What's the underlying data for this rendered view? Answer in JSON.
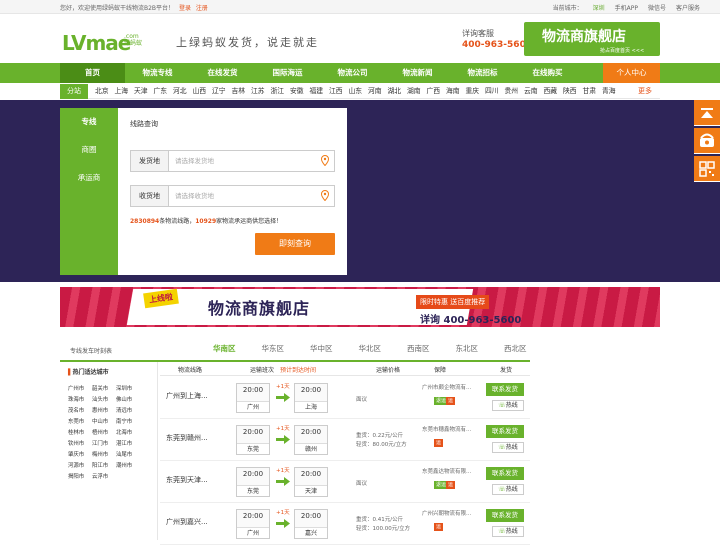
{
  "topbar": {
    "welcome": "您好，欢迎使用绿蚂蚁干线物流B2B平台！",
    "login": "登录",
    "register": "注册",
    "current_city_label": "当前城市：",
    "current_city": "深圳",
    "mobile_app": "手机APP",
    "wechat": "微信号",
    "service": "客户服务"
  },
  "header": {
    "logo_text": "LVmae",
    "logo_sub1": ".com",
    "logo_sub2": "绿蚂蚁",
    "slogan": "上绿蚂蚁发货，说走就走",
    "hotline_label": "详询客服",
    "hotline": "400-963-5600",
    "banner_title": "物流商旗舰店",
    "banner_sub": "抢占百度首页 <<<"
  },
  "nav": {
    "items": [
      "首页",
      "物流专线",
      "在线发货",
      "国际海运",
      "物流公司",
      "物流新闻",
      "物流招标",
      "在线购买"
    ],
    "user_center": "个人中心"
  },
  "provinces": {
    "tag": "分站",
    "list": [
      "北京",
      "上海",
      "天津",
      "广东",
      "河北",
      "山西",
      "辽宁",
      "吉林",
      "江苏",
      "浙江",
      "安徽",
      "福建",
      "江西",
      "山东",
      "河南",
      "湖北",
      "湖南",
      "广西",
      "海南",
      "重庆",
      "四川",
      "贵州",
      "云南",
      "西藏",
      "陕西",
      "甘肃",
      "青海"
    ],
    "more": "更多"
  },
  "search_panel": {
    "tabs": [
      "专线",
      "商圈",
      "承运商"
    ],
    "title": "线路查询",
    "from_label": "发货地",
    "from_placeholder": "请选择发货地",
    "to_label": "收货地",
    "to_placeholder": "请选择收货地",
    "stat_lines": "2830894",
    "stat_text1": "条物流线路，",
    "stat_carriers": "10929",
    "stat_text2": "家物流承运商供您选择！",
    "query_button": "即刻查询"
  },
  "ad": {
    "online": "上线啦",
    "title": "物流商旗舰店",
    "promo": "限时特惠 送百度推荐",
    "phone": "详询 400-963-5600"
  },
  "lines_section": {
    "title": "专线发车时刻表",
    "region_tabs": [
      "华南区",
      "华东区",
      "华中区",
      "华北区",
      "西南区",
      "东北区",
      "西北区"
    ],
    "hot_cities_title": "热门适达城市",
    "hot_cities": [
      "广州市",
      "韶关市",
      "深圳市",
      "珠海市",
      "汕头市",
      "佛山市",
      "茂名市",
      "惠州市",
      "清远市",
      "东莞市",
      "中山市",
      "南宁市",
      "桂林市",
      "梧州市",
      "北海市",
      "钦州市",
      "江门市",
      "湛江市",
      "肇庆市",
      "梅州市",
      "汕尾市",
      "河源市",
      "阳江市",
      "潮州市",
      "揭阳市",
      "云浮市"
    ],
    "columns": [
      "物流线路",
      "运输班次",
      "预计到达时间",
      "运输价格",
      "保障",
      "发货"
    ],
    "rows": [
      {
        "route": "广州到上海...",
        "dep_time": "20:00",
        "dep_city": "广州",
        "plus": "+1天",
        "arr_time": "20:00",
        "arr_city": "上海",
        "price_lines": [
          "面议"
        ],
        "company": "广州市颇企物流有...",
        "badges": [
          "退运",
          "运"
        ],
        "contact": "联系发货",
        "hotline": "热线"
      },
      {
        "route": "东莞到赣州...",
        "dep_time": "20:00",
        "dep_city": "东莞",
        "plus": "+1天",
        "arr_time": "20:00",
        "arr_city": "赣州",
        "price_lines": [
          "重货：0.22元/公斤",
          "轻货：80.00元/立方"
        ],
        "company": "东莞市穗鑫物流有...",
        "badges": [
          "运"
        ],
        "contact": "联系发货",
        "hotline": "热线"
      },
      {
        "route": "东莞到天津...",
        "dep_time": "20:00",
        "dep_city": "东莞",
        "plus": "+1天",
        "arr_time": "20:00",
        "arr_city": "天津",
        "price_lines": [
          "面议"
        ],
        "company": "东莞鑫达物流有限...",
        "badges": [
          "退运",
          "运"
        ],
        "contact": "联系发货",
        "hotline": "热线"
      },
      {
        "route": "广州到嘉兴...",
        "dep_time": "20:00",
        "dep_city": "广州",
        "plus": "+1天",
        "arr_time": "20:00",
        "arr_city": "嘉兴",
        "price_lines": [
          "重货：0.41元/公斤",
          "轻货：100.00元/立方"
        ],
        "company": "广州兴朝物流有限...",
        "badges": [
          "运"
        ],
        "contact": "联系发货",
        "hotline": "热线"
      }
    ]
  },
  "colors": {
    "brand": "#69b22c",
    "accent": "#f07b16",
    "hero_bg": "#2d2457"
  },
  "side_icons": [
    "top-icon",
    "phone-icon",
    "qrcode-icon"
  ]
}
